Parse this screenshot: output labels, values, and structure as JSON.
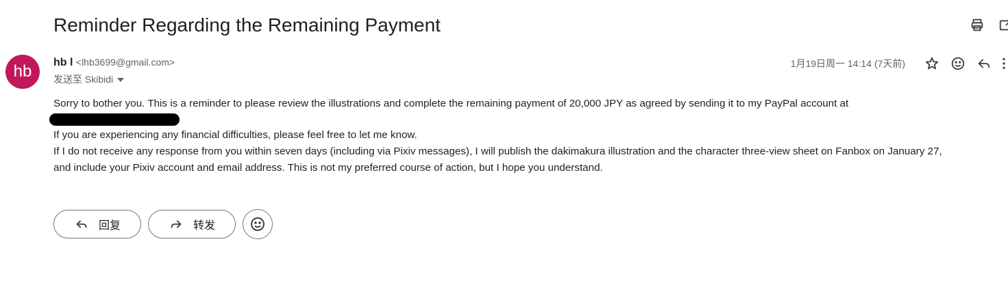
{
  "email": {
    "subject": "Reminder Regarding the Remaining Payment",
    "sender": {
      "avatar_text": "hb",
      "name": "hb l",
      "email": "<lhb3699@gmail.com>"
    },
    "recipient_label": "发送至 Skibidi",
    "date": "1月19日周一 14:14 (7天前)",
    "body": {
      "line1": "Sorry to bother you. This is a reminder to please review the illustrations and complete the remaining payment of 20,000 JPY as agreed by sending it to my PayPal account at",
      "line2": "If you are experiencing any financial difficulties, please feel free to let me know.",
      "line3": "If I do not receive any response from you within seven days (including via Pixiv messages), I will publish the dakimakura illustration and the character three-view sheet on Fanbox on January 27,",
      "line4": "and include your Pixiv account and email address. This is not my preferred course of action, but I hope you understand."
    },
    "actions": {
      "reply_label": "回复",
      "forward_label": "转发"
    }
  },
  "icons": {
    "print": "print-icon",
    "open_new_window": "open-in-new-window-icon",
    "star": "star-icon",
    "emoji": "emoji-icon",
    "reply": "reply-icon",
    "more": "more-vert-icon",
    "forward": "forward-icon"
  },
  "colors": {
    "avatar_bg": "#c2185b",
    "text": "#1f1f1f",
    "muted": "#5f6368",
    "outline": "#747775"
  }
}
